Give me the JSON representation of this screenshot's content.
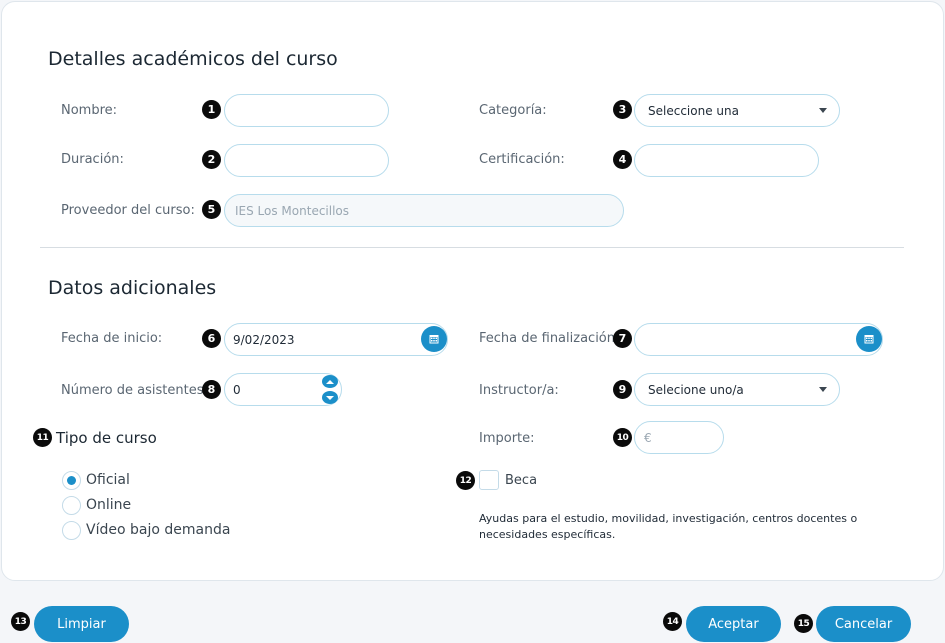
{
  "section1": {
    "title": "Detalles académicos del curso",
    "nombre_label": "Nombre:",
    "nombre_value": "",
    "duracion_label": "Duración:",
    "duracion_value": "",
    "proveedor_label": "Proveedor del curso:",
    "proveedor_value": "IES Los Montecillos",
    "categoria_label": "Categoría:",
    "categoria_value": "Seleccione una",
    "certificacion_label": "Certificación:",
    "certificacion_value": ""
  },
  "section2": {
    "title": "Datos adicionales",
    "fecha_inicio_label": "Fecha de inicio:",
    "fecha_inicio_value": "9/02/2023",
    "fecha_fin_label": "Fecha de finalización:",
    "fecha_fin_value": "",
    "asistentes_label": "Número de asistentes:",
    "asistentes_value": "0",
    "instructor_label": "Instructor/a:",
    "instructor_value": "Selecione uno/a",
    "importe_label": "Importe:",
    "importe_placeholder": "€",
    "tipo_label": "Tipo de curso",
    "tipo_options": [
      "Oficial",
      "Online",
      "Vídeo bajo demanda"
    ],
    "tipo_selected": "Oficial",
    "beca_label": "Beca",
    "beca_checked": false,
    "beca_help": "Ayudas para el estudio, movilidad, investigación, centros docentes o necesidades específicas."
  },
  "badges": [
    "1",
    "2",
    "3",
    "4",
    "5",
    "6",
    "7",
    "8",
    "9",
    "10",
    "11",
    "12",
    "13",
    "14",
    "15"
  ],
  "footer": {
    "limpiar_label": "Limpiar",
    "aceptar_label": "Aceptar",
    "cancelar_label": "Cancelar"
  },
  "colors": {
    "accent": "#1b8fc9",
    "field_border": "#b7dcec",
    "badge": "#0a0a0a"
  }
}
